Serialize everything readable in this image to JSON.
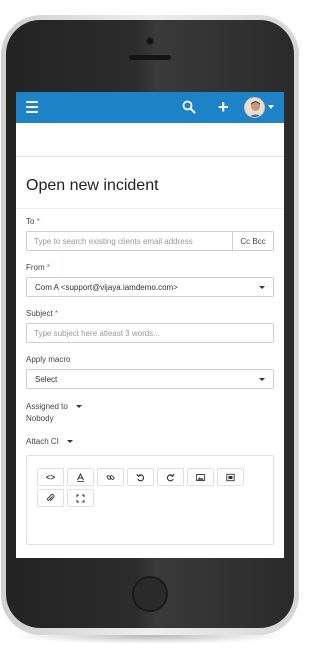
{
  "form": {
    "title": "Open new incident",
    "to_label": "To",
    "required_mark": "*",
    "to_placeholder": "Type to search existing clients email address",
    "ccbcc_label": "Cc Bcc",
    "from_label": "From",
    "from_value": "Com A <support@vijaya.iamdemo.com>",
    "subject_label": "Subject",
    "subject_placeholder": "Type subject here atleast 3 words...",
    "macro_label": "Apply macro",
    "macro_value": "Select",
    "assigned_label": "Assigned to",
    "assigned_value": "Nobody",
    "attach_label": "Attach CI"
  },
  "editor": {
    "toolbar": [
      "code-icon",
      "text-format-icon",
      "link-icon",
      "undo-icon",
      "redo-icon",
      "image-icon",
      "media-icon",
      "attachment-icon",
      "fullscreen-icon"
    ],
    "code_label": "<>"
  },
  "colors": {
    "topbar": "#1d82c6",
    "required": "#d9534f"
  }
}
